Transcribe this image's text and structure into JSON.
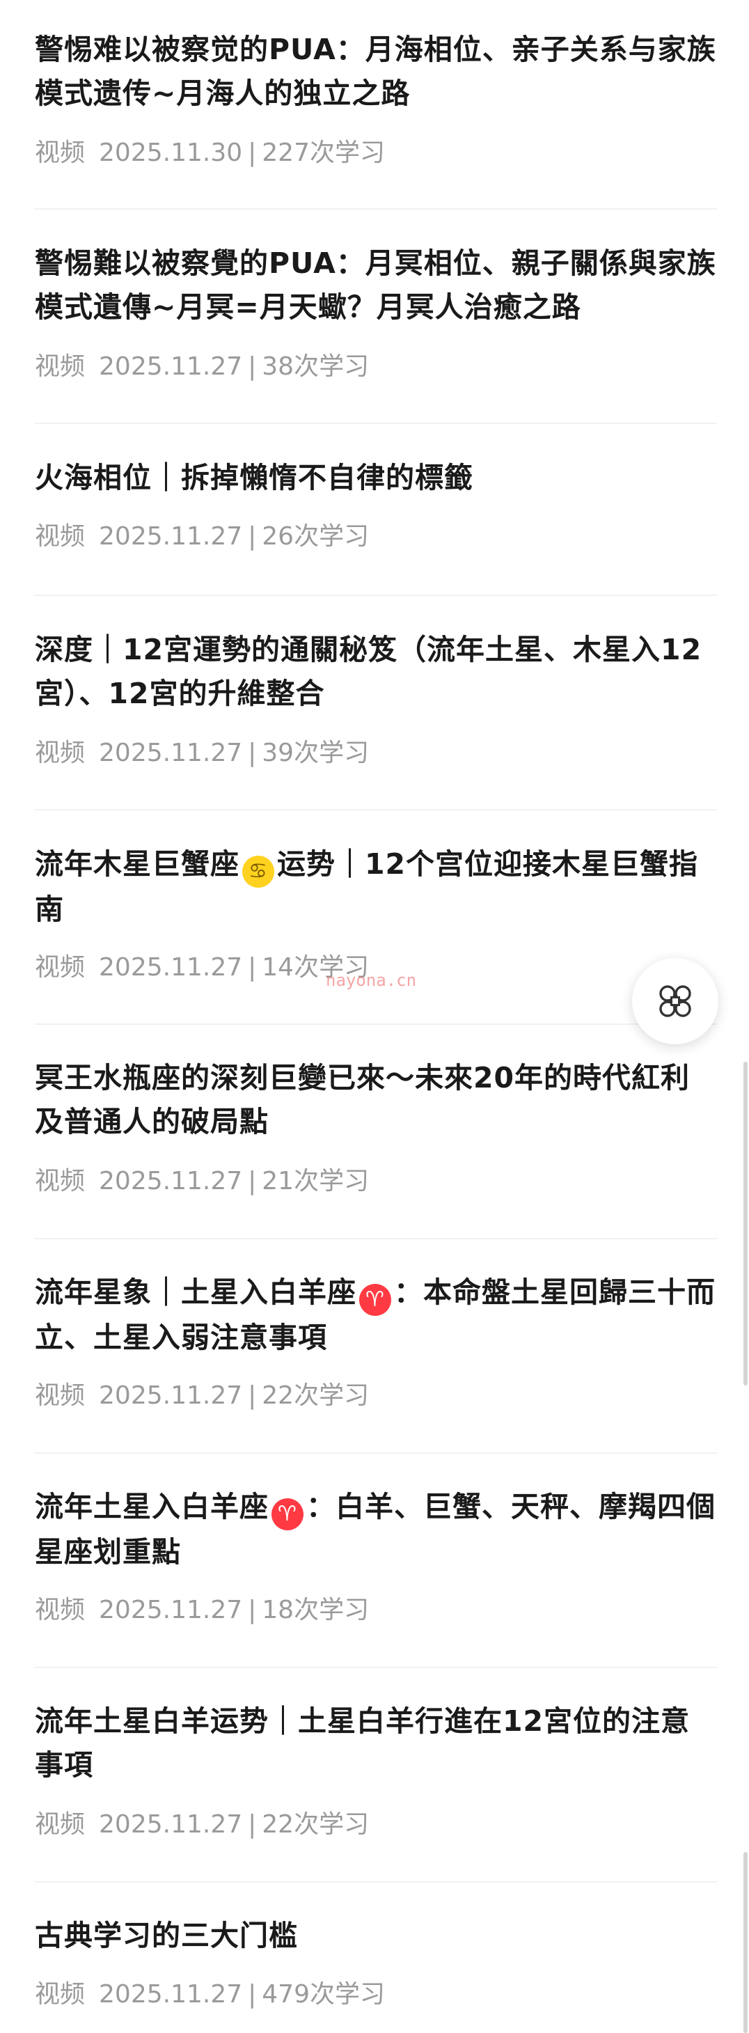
{
  "items": [
    {
      "title": "警惕难以被察觉的PUA：月海相位、亲子关系与家族模式遗传~月海人的独立之路",
      "type": "视频",
      "date": "2025.11.30",
      "views": "227次学习"
    },
    {
      "title": "警惕難以被察覺的PUA：月冥相位、親子關係與家族模式遺傳~月冥=月天蠍？月冥人治癒之路",
      "type": "视频",
      "date": "2025.11.27",
      "views": "38次学习"
    },
    {
      "title": "火海相位｜拆掉懶惰不自律的標籤",
      "type": "视频",
      "date": "2025.11.27",
      "views": "26次学习"
    },
    {
      "title": "深度｜12宮運勢的通關秘笈（流年土星、木星入12宮）、12宮的升維整合",
      "type": "视频",
      "date": "2025.11.27",
      "views": "39次学习"
    },
    {
      "title_pre": "流年木星巨蟹座",
      "title_icon": "♋",
      "title_post": "运势｜12个宫位迎接木星巨蟹指南",
      "type": "视频",
      "date": "2025.11.27",
      "views": "14次学习"
    },
    {
      "title": "冥王水瓶座的深刻巨變已來～未來20年的時代紅利及普通人的破局點",
      "type": "视频",
      "date": "2025.11.27",
      "views": "21次学习"
    },
    {
      "title_pre": "流年星象｜土星入白羊座",
      "title_icon": "♈",
      "title_post": "：本命盤土星回歸三十而立、土星入弱注意事項",
      "type": "视频",
      "date": "2025.11.27",
      "views": "22次学习"
    },
    {
      "title_pre": "流年土星入白羊座",
      "title_icon": "♈",
      "title_post": "：白羊、巨蟹、天秤、摩羯四個星座划重點",
      "type": "视频",
      "date": "2025.11.27",
      "views": "18次学习"
    },
    {
      "title": "流年土星白羊运势｜土星白羊行進在12宮位的注意事項",
      "type": "视频",
      "date": "2025.11.27",
      "views": "22次学习"
    },
    {
      "title": "古典学习的三大门槛",
      "type": "视频",
      "date": "2025.11.27",
      "views": "479次学习"
    }
  ],
  "meta_separator": "|",
  "watermark": "nayona.cn",
  "colors": {
    "title": "#1a1a1a",
    "meta": "#9a9a9a",
    "cancer_badge": "#ffd21f",
    "aries_badge": "#ff3a43"
  },
  "icons": {
    "floating_button": "clover-apps-icon",
    "cancer": "cancer-zodiac-icon",
    "aries": "aries-zodiac-icon"
  }
}
